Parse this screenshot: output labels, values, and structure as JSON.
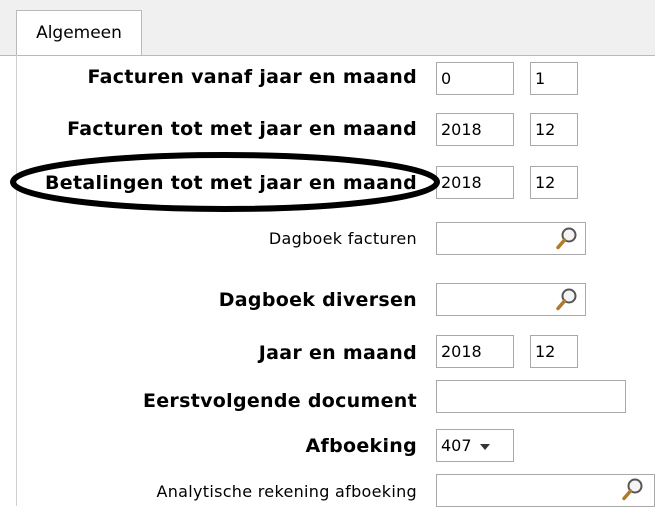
{
  "tabs": [
    {
      "label": "Algemeen"
    }
  ],
  "fields": {
    "facturen_vanaf": {
      "label": "Facturen vanaf jaar en maand",
      "year": "0",
      "month": "1"
    },
    "facturen_tot": {
      "label": "Facturen tot met jaar en maand",
      "year": "2018",
      "month": "12"
    },
    "betalingen_tot": {
      "label": "Betalingen tot met jaar en maand",
      "year": "2018",
      "month": "12"
    },
    "dagboek_facturen": {
      "label": "Dagboek facturen",
      "value": ""
    },
    "dagboek_diversen": {
      "label": "Dagboek diversen",
      "value": ""
    },
    "jaar_maand": {
      "label": "Jaar en maand",
      "year": "2018",
      "month": "12"
    },
    "eerstvolgende": {
      "label": "Eerstvolgende document",
      "value": ""
    },
    "afboeking": {
      "label": "Afboeking",
      "value": "407"
    },
    "analytische": {
      "label": "Analytische rekening afboeking",
      "value": ""
    }
  },
  "icons": {
    "lookup": "magnifier-icon",
    "dropdown": "chevron-down-icon"
  },
  "colors": {
    "highlight_ellipse": "#000000"
  }
}
